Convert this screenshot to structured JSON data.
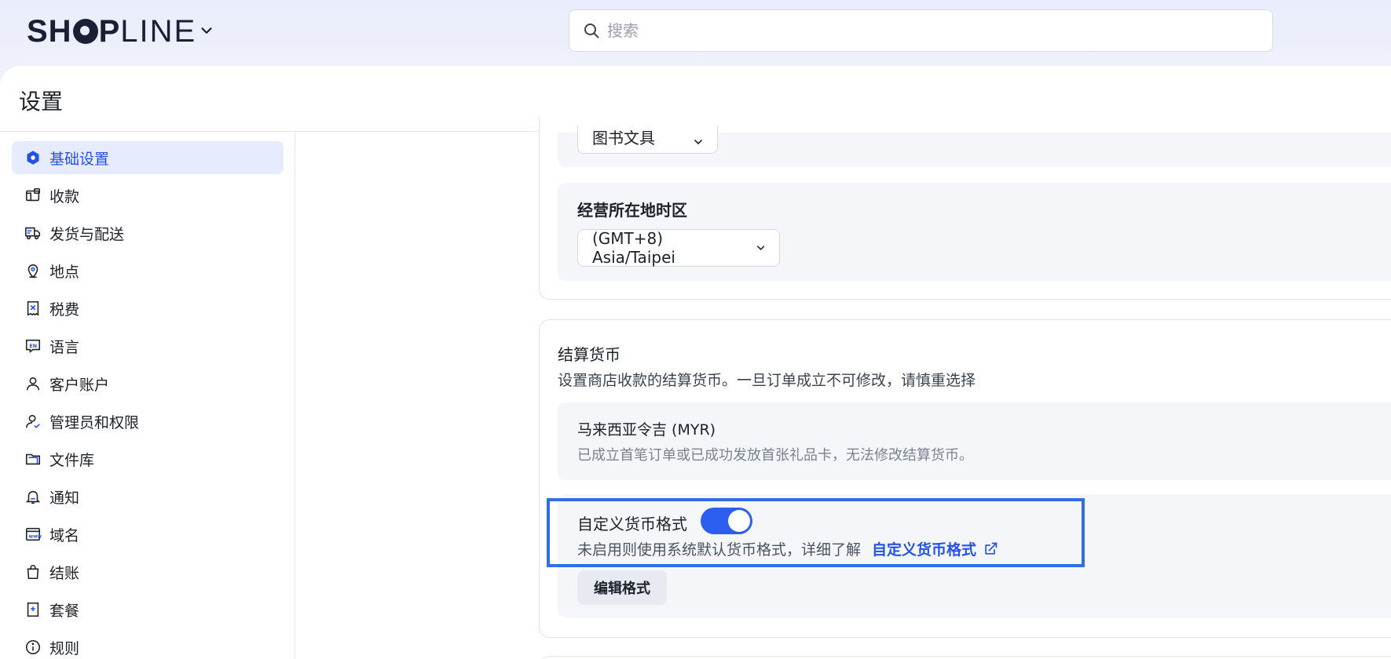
{
  "topbar": {
    "logo_bold_1": "SH",
    "logo_bold_2": "P",
    "logo_thin": "LINE",
    "search_placeholder": "搜索"
  },
  "page": {
    "title": "设置"
  },
  "sidebar": {
    "items": [
      {
        "label": "基础设置",
        "icon": "hexagon-icon",
        "active": true
      },
      {
        "label": "收款",
        "icon": "wallet-icon"
      },
      {
        "label": "发货与配送",
        "icon": "truck-icon"
      },
      {
        "label": "地点",
        "icon": "location-pin-icon"
      },
      {
        "label": "税费",
        "icon": "tax-receipt-icon"
      },
      {
        "label": "语言",
        "icon": "language-en-icon"
      },
      {
        "label": "客户账户",
        "icon": "user-icon"
      },
      {
        "label": "管理员和权限",
        "icon": "user-check-icon"
      },
      {
        "label": "文件库",
        "icon": "folder-icon"
      },
      {
        "label": "通知",
        "icon": "bell-icon"
      },
      {
        "label": "域名",
        "icon": "domain-icon"
      },
      {
        "label": "结账",
        "icon": "shopping-bag-icon"
      },
      {
        "label": "套餐",
        "icon": "plan-icon"
      },
      {
        "label": "规则",
        "icon": "info-icon"
      }
    ]
  },
  "content": {
    "industry_select_value": "图书文具",
    "timezone": {
      "label": "经营所在地时区",
      "value": "(GMT+8) Asia/Taipei"
    },
    "currency": {
      "title": "结算货币",
      "description": "设置商店收款的结算货币。一旦订单成立不可修改，请慎重选择",
      "current_name": "马来西亚令吉 (MYR)",
      "current_note": "已成立首笔订单或已成功发放首张礼品卡，无法修改结算货币。",
      "custom_format_label": "自定义货币格式",
      "custom_format_enabled": true,
      "custom_format_hint": "未启用则使用系统默认货币格式，详细了解",
      "custom_format_link": "自定义货币格式",
      "edit_button": "编辑格式"
    }
  },
  "colors": {
    "accent": "#2453e6",
    "toggle_on": "#2c5ef0",
    "highlight_border": "#2f6fe4"
  }
}
